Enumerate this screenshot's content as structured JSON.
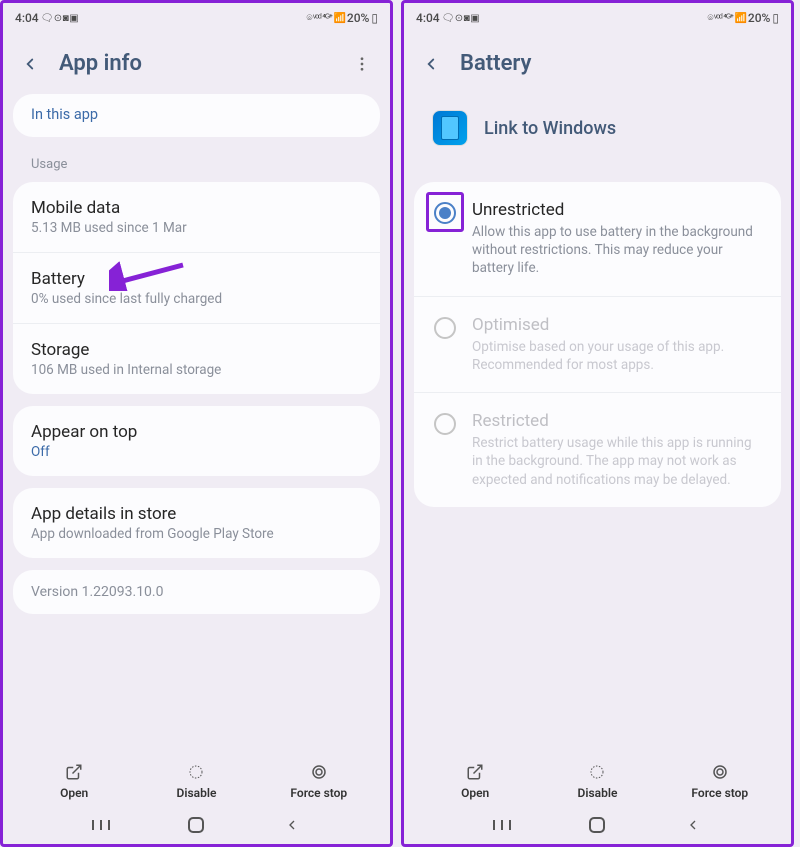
{
  "status": {
    "time": "4:04",
    "left_icons": "🗨 ⊙ ◙ ▣",
    "right_icons": "⌾ ᵛᵒᵈ ⁴ᴳ⁺ 📶",
    "battery": "20%"
  },
  "left": {
    "title": "App info",
    "in_this_app": "In this app",
    "usage_label": "Usage",
    "mobile_data": {
      "title": "Mobile data",
      "sub": "5.13 MB used since 1 Mar"
    },
    "battery": {
      "title": "Battery",
      "sub": "0% used since last fully charged"
    },
    "storage": {
      "title": "Storage",
      "sub": "106 MB used in Internal storage"
    },
    "appear": {
      "title": "Appear on top",
      "sub": "Off"
    },
    "details": {
      "title": "App details in store",
      "sub": "App downloaded from Google Play Store"
    },
    "version": "Version 1.22093.10.0"
  },
  "right": {
    "title": "Battery",
    "app_name": "Link to Windows",
    "unrestricted": {
      "title": "Unrestricted",
      "sub": "Allow this app to use battery in the background without restrictions. This may reduce your battery life."
    },
    "optimised": {
      "title": "Optimised",
      "sub": "Optimise based on your usage of this app. Recommended for most apps."
    },
    "restricted": {
      "title": "Restricted",
      "sub": "Restrict battery usage while this app is running in the background. The app may not work as expected and notifications may be delayed."
    }
  },
  "actions": {
    "open": "Open",
    "disable": "Disable",
    "force_stop": "Force stop"
  }
}
